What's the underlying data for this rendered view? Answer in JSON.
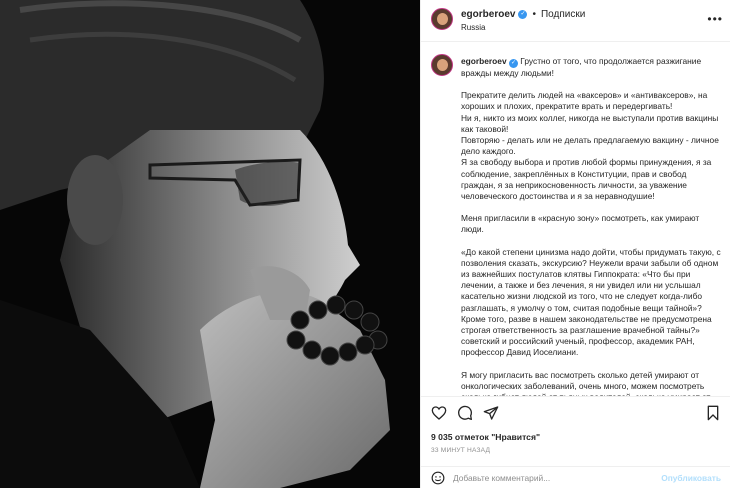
{
  "post": {
    "username": "egorberoev",
    "follow_label": "Подписки",
    "location": "Russia",
    "caption_username": "egorberoev",
    "caption_paragraphs": [
      "Грустно от того, что продолжается разжигание вражды между людьми!",
      "Прекратите делить людей на «ваксеров» и «антиваксеров», на хороших и плохих, прекратите врать и передергивать!\nНи я, никто из моих коллег, никогда не выступали против вакцины как таковой!\nПовторяю - делать или не делать предлагаемую вакцину - личное дело каждого.\nЯ за свободу выбора и против любой формы принуждения, я за соблюдение, закреплённых в Конституции, прав и свобод граждан, я за неприкосновенность личности, за уважение человеческого достоинства и я за неравнодушие!",
      "Меня пригласили в «красную зону» посмотреть, как умирают люди.",
      "«До какой степени цинизма надо дойти, чтобы придумать такую, с позволения сказать, экскурсию? Неужели врачи забыли об одном из важнейших постулатов клятвы Гиппократа: «Что бы при лечении, а также и без лечения, я ни увидел или ни услышал касательно жизни людской из того, что не следует когда-либо разглашать, я умолчу о том, считая подобные вещи тайной»? Кроме того, разве в нашем законодательстве не предусмотрена строгая ответственность за разглашение врачебной тайны?» советский и российский ученый, профессор, академик РАН, профессор Давид Иоселиани.",
      "Я могу пригласить вас посмотреть сколько детей умирают от онкологических заболеваний, очень много, можем посмотреть сколько гибнет людей от пьяных водителей, сколько умирает от"
    ],
    "likes": "9 035 отметок \"Нравится\"",
    "time_ago": "33 МИНУТ НАЗАД",
    "comment_placeholder": "Добавьте комментарий...",
    "publish_label": "Опубликовать"
  },
  "icons": {
    "more": "more-options-icon",
    "like": "heart-icon",
    "comment": "comment-icon",
    "share": "paper-plane-icon",
    "save": "bookmark-icon",
    "emoji": "smiley-icon",
    "verified": "verified-badge-icon"
  },
  "colors": {
    "verified": "#3897f0",
    "publish_disabled": "#b2dffc",
    "secondary_text": "#8e8e8e",
    "border": "#efefef"
  }
}
